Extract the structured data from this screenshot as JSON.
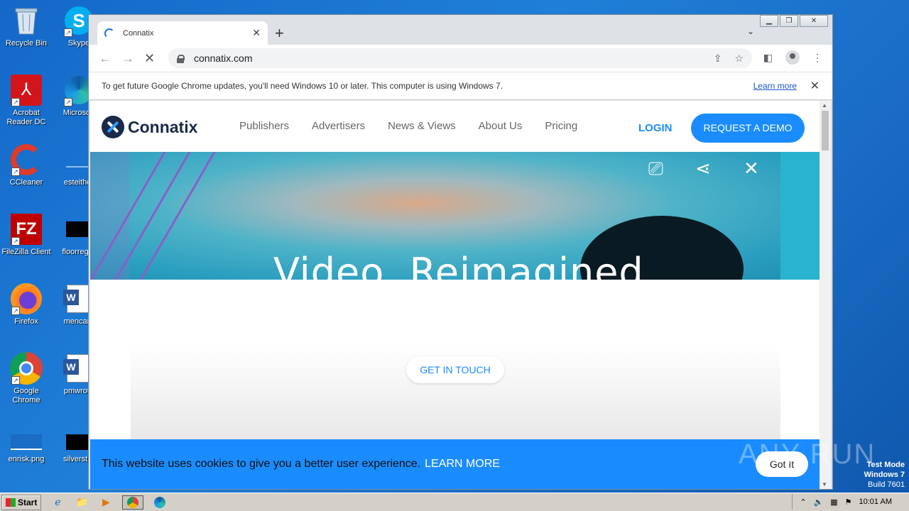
{
  "desktop": {
    "icons_col1": [
      {
        "label": "Recycle Bin"
      },
      {
        "label": "Acrobat Reader DC"
      },
      {
        "label": "CCleaner"
      },
      {
        "label": "FileZilla Client"
      },
      {
        "label": "Firefox"
      },
      {
        "label": "Google Chrome"
      },
      {
        "label": "enrisk.png"
      }
    ],
    "icons_col2": [
      {
        "label": "Skype"
      },
      {
        "label": "Microsoft"
      },
      {
        "label": "esteither"
      },
      {
        "label": "floorregar"
      },
      {
        "label": "mencare"
      },
      {
        "label": "pmwrote"
      },
      {
        "label": "silverstru"
      }
    ]
  },
  "browser": {
    "tab_title": "Connatix",
    "url": "connatix.com",
    "infobar_text": "To get future Google Chrome updates, you'll need Windows 10 or later. This computer is using Windows 7.",
    "infobar_link": "Learn more"
  },
  "site": {
    "logo_text": "Connatix",
    "nav": [
      "Publishers",
      "Advertisers",
      "News & Views",
      "About Us",
      "Pricing"
    ],
    "login": "LOGIN",
    "demo": "REQUEST A DEMO",
    "hero_title": "Video. Reimagined",
    "get_in_touch": "GET IN TOUCH",
    "cookie_text": "This website uses cookies to give you a better user experience.",
    "cookie_learn": "LEARN MORE",
    "cookie_button": "Got It"
  },
  "watermark": "ANY RUN",
  "system": {
    "testmode_line1": "Test Mode",
    "testmode_line2": "Windows 7",
    "testmode_line3": "Build 7601",
    "start_label": "Start",
    "clock": "10:01 AM"
  },
  "colors": {
    "accent": "#1a8cff",
    "desktop": "#1f7fd8"
  }
}
